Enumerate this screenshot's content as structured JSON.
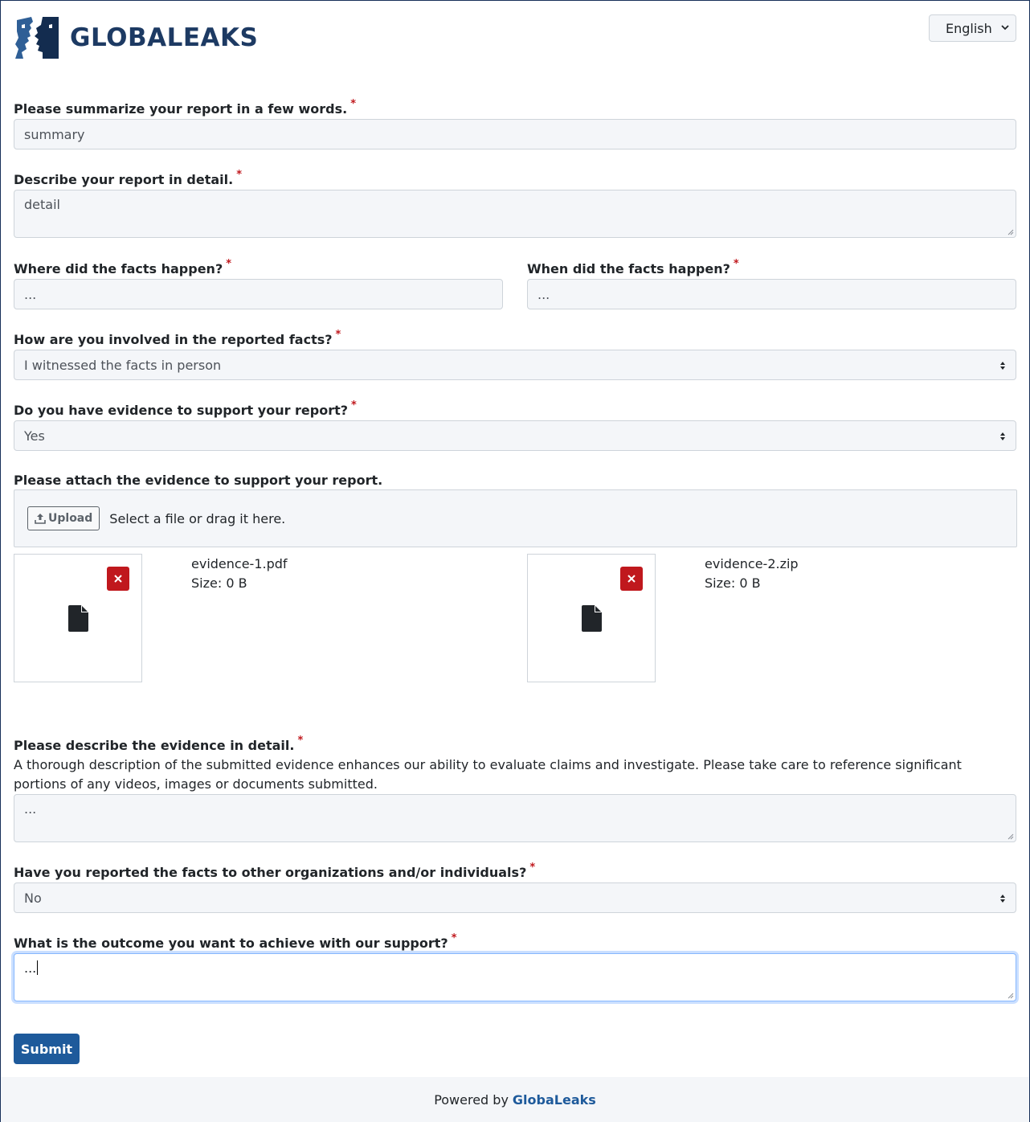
{
  "header": {
    "logo_text": "GLOBALEAKS",
    "language": "English"
  },
  "form": {
    "summary": {
      "label": "Please summarize your report in a few words.",
      "value": "summary"
    },
    "detail": {
      "label": "Describe your report in detail.",
      "value": "detail"
    },
    "where": {
      "label": "Where did the facts happen?",
      "value": "..."
    },
    "when": {
      "label": "When did the facts happen?",
      "value": "..."
    },
    "involvement": {
      "label": "How are you involved in the reported facts?",
      "value": "I witnessed the facts in person"
    },
    "evidence": {
      "label": "Do you have evidence to support your report?",
      "value": "Yes"
    },
    "attach": {
      "label": "Please attach the evidence to support your report.",
      "upload_label": "Upload",
      "hint": "Select a file or drag it here.",
      "files": [
        {
          "name": "evidence-1.pdf",
          "size": "Size: 0 B"
        },
        {
          "name": "evidence-2.zip",
          "size": "Size: 0 B"
        }
      ]
    },
    "evidence_desc": {
      "label": "Please describe the evidence in detail.",
      "help": "A thorough description of the submitted evidence enhances our ability to evaluate claims and investigate. Please take care to reference significant portions of any videos, images or documents submitted.",
      "value": "..."
    },
    "reported_other": {
      "label": "Have you reported the facts to other organizations and/or individuals?",
      "value": "No"
    },
    "outcome": {
      "label": "What is the outcome you want to achieve with our support?",
      "value": "..."
    },
    "required_mark": "*",
    "submit_label": "Submit"
  },
  "footer": {
    "prefix": "Powered by",
    "brand": "GlobaLeaks"
  },
  "colors": {
    "brand": "#1d3a63",
    "link": "#1e5a9b",
    "danger": "#c0181d",
    "field_bg": "#f4f6f9"
  }
}
